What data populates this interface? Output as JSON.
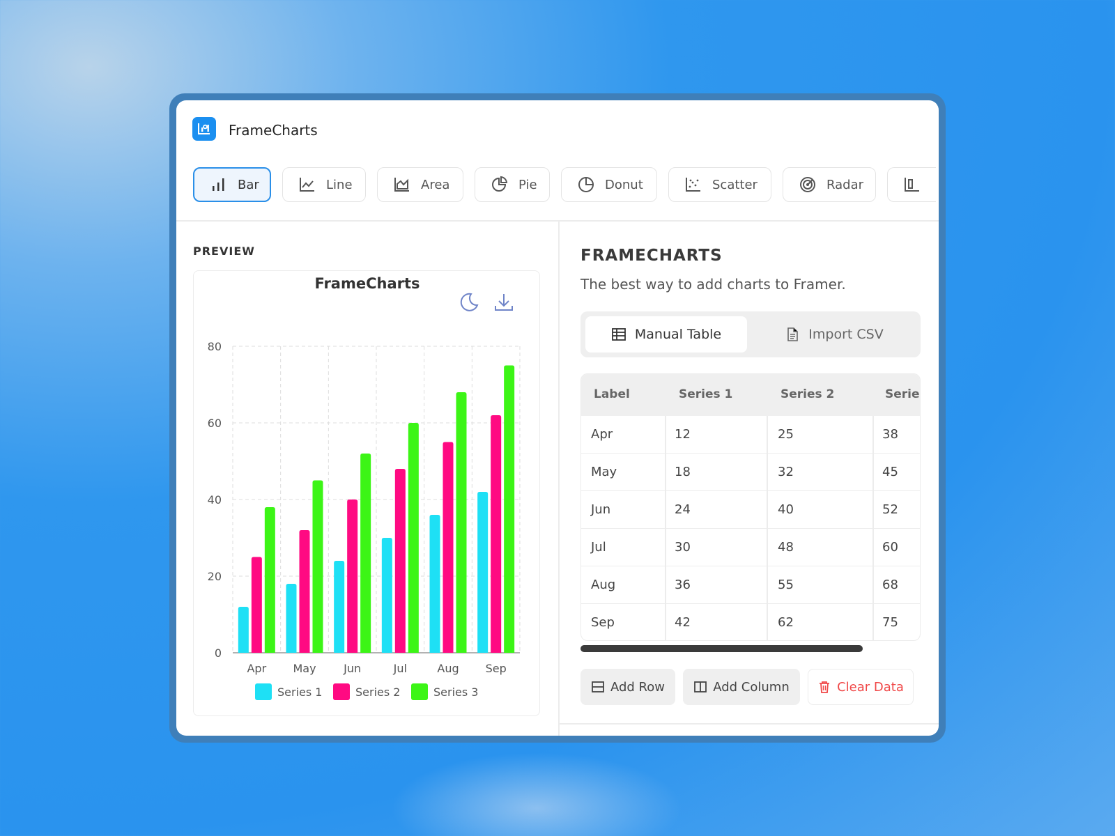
{
  "app": {
    "title": "FrameCharts"
  },
  "chart_types": [
    {
      "label": "Bar",
      "icon": "bar-chart-icon",
      "active": true
    },
    {
      "label": "Line",
      "icon": "line-chart-icon",
      "active": false
    },
    {
      "label": "Area",
      "icon": "area-chart-icon",
      "active": false
    },
    {
      "label": "Pie",
      "icon": "pie-chart-icon",
      "active": false
    },
    {
      "label": "Donut",
      "icon": "donut-chart-icon",
      "active": false
    },
    {
      "label": "Scatter",
      "icon": "scatter-chart-icon",
      "active": false
    },
    {
      "label": "Radar",
      "icon": "radar-chart-icon",
      "active": false
    }
  ],
  "preview": {
    "label": "PREVIEW"
  },
  "panel": {
    "title": "FRAMECHARTS",
    "subtitle": "The best way to add charts to Framer.",
    "modes": {
      "manual": "Manual Table",
      "import": "Import CSV"
    },
    "table": {
      "headers": [
        "Label",
        "Series 1",
        "Series 2",
        "Serie"
      ],
      "rows": [
        [
          "Apr",
          "12",
          "25",
          "38"
        ],
        [
          "May",
          "18",
          "32",
          "45"
        ],
        [
          "Jun",
          "24",
          "40",
          "52"
        ],
        [
          "Jul",
          "30",
          "48",
          "60"
        ],
        [
          "Aug",
          "36",
          "55",
          "68"
        ],
        [
          "Sep",
          "42",
          "62",
          "75"
        ]
      ]
    },
    "actions": {
      "add_row": "Add Row",
      "add_column": "Add Column",
      "clear": "Clear Data"
    }
  },
  "chart_data": {
    "type": "bar",
    "title": "FrameCharts",
    "categories": [
      "Apr",
      "May",
      "Jun",
      "Jul",
      "Aug",
      "Sep"
    ],
    "series": [
      {
        "name": "Series 1",
        "color": "#1ee0f5",
        "values": [
          12,
          18,
          24,
          30,
          36,
          42
        ]
      },
      {
        "name": "Series 2",
        "color": "#ff0a82",
        "values": [
          25,
          32,
          40,
          48,
          55,
          62
        ]
      },
      {
        "name": "Series 3",
        "color": "#3cf516",
        "values": [
          38,
          45,
          52,
          60,
          68,
          75
        ]
      }
    ],
    "ylim": [
      0,
      80
    ],
    "yticks": [
      0,
      20,
      40,
      60,
      80
    ],
    "grid": true,
    "legend": "bottom"
  },
  "colors": {
    "accent": "#1b8ff0",
    "danger": "#f04848"
  }
}
